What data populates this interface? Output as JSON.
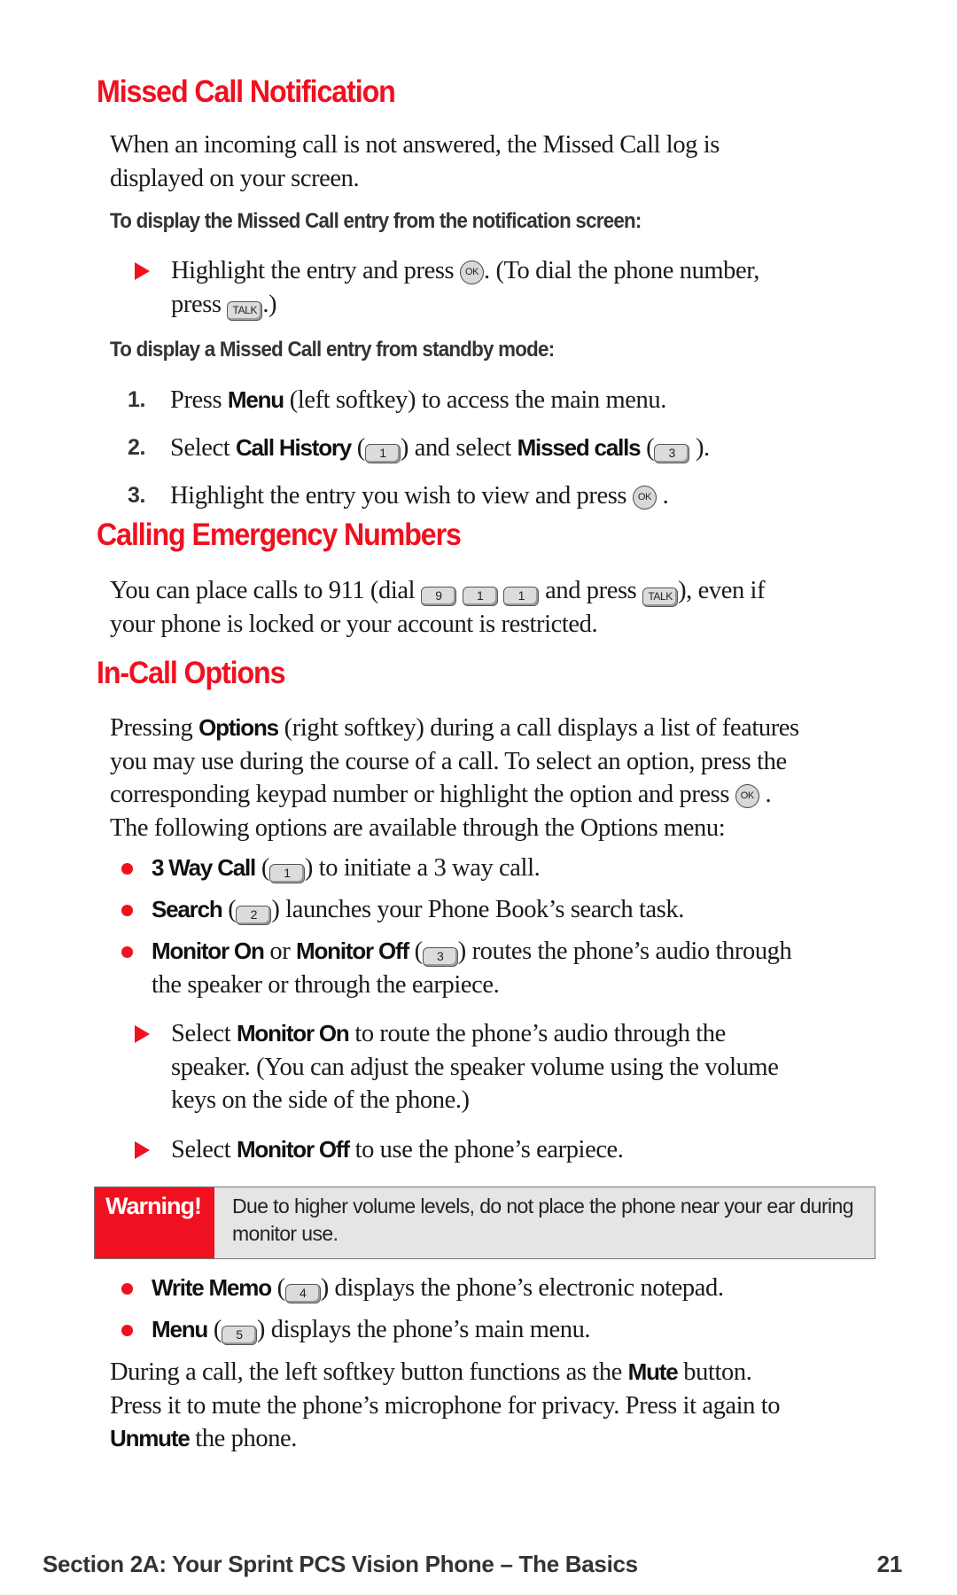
{
  "sections": {
    "missed": {
      "title": "Missed Call Notification",
      "intro": "When an incoming call is not answered, the Missed Call log is displayed on your screen.",
      "sub1": "To display the Missed Call entry from the notification screen:",
      "step_a_1": "Highlight the entry and press",
      "step_a_2": ". (To dial the phone number,",
      "step_a_3": "press",
      "step_a_4": ".)",
      "sub2": "To display a Missed Call entry from standby mode:",
      "steps": [
        {
          "num": "1.",
          "pre": "Press ",
          "bold": "Menu",
          "post": " (left softkey) to access the main menu."
        },
        {
          "num": "2.",
          "pre": "Select ",
          "bold": "Call History",
          "mid1": " (",
          "key1": "1",
          "mid2": ") and select ",
          "bold2": "Missed calls",
          "mid3": " (",
          "key2": "3",
          "post": " )."
        },
        {
          "num": "3.",
          "pre": "Highlight the entry you wish to view and press",
          "post": "."
        }
      ]
    },
    "emergency": {
      "title": "Calling Emergency Numbers",
      "text1": "You can place calls to 911 (dial",
      "keys": [
        "9",
        "1",
        "1"
      ],
      "text2": "and press",
      "text3": "), even if",
      "text4": "your phone is locked or your account is restricted."
    },
    "incall": {
      "title": "In-Call Options",
      "intro_pre": "Pressing ",
      "intro_bold": "Options",
      "intro_1": " (right softkey) during a call displays a list of features",
      "intro_2": "you may use during the course of a call. To select an option, press the",
      "intro_3": "corresponding keypad number or highlight the option and press",
      "intro_4": ".",
      "intro_5": "The following options are available through the Options menu:",
      "options": [
        {
          "bold": "3 Way Call",
          "key": "1",
          "text": ") to initiate a 3 way call."
        },
        {
          "bold": "Search",
          "key": "2",
          "text": ") launches your Phone Book’s search task."
        },
        {
          "bold": "Monitor On",
          "or": " or ",
          "bold2": "Monitor Off",
          "key": "3",
          "text": ") routes the phone’s audio through",
          "text2": "the speaker or through the earpiece."
        }
      ],
      "monitor_on_pre": "Select ",
      "monitor_on_bold": "Monitor On",
      "monitor_on_1": " to route the phone’s audio through the",
      "monitor_on_2": "speaker. (You can adjust the speaker volume using the volume",
      "monitor_on_3": "keys on the side of the phone.)",
      "monitor_off_pre": "Select ",
      "monitor_off_bold": "Monitor Off",
      "monitor_off_post": " to use the phone’s earpiece.",
      "warning_label": "Warning!",
      "warning_text": "Due to higher volume levels, do not place the phone near your ear during monitor use.",
      "options2": [
        {
          "bold": "Write Memo",
          "key": "4",
          "text": ") displays the phone’s electronic notepad."
        },
        {
          "bold": "Menu",
          "key": "5",
          "text": ") displays the phone’s main menu."
        }
      ],
      "mute_1": "During a call, the left softkey button functions as the ",
      "mute_bold": "Mute",
      "mute_2": " button.",
      "mute_3": "Press it to mute the phone’s microphone for privacy. Press it again to",
      "unmute_bold": "Unmute",
      "unmute_post": " the phone."
    }
  },
  "keys": {
    "ok": "OK",
    "talk": "TALK",
    "open_paren": "("
  },
  "footer": {
    "section": "Section 2A: Your Sprint PCS Vision Phone – The Basics",
    "page": "21"
  },
  "colors": {
    "accent_red": "#f0101f",
    "warning_bg": "#e5e5e5"
  }
}
